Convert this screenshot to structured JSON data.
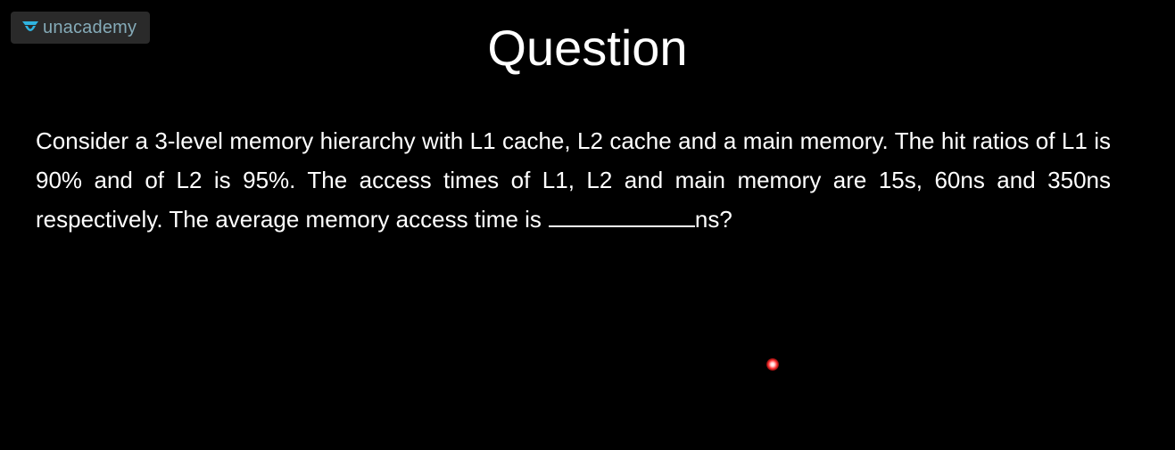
{
  "watermark": {
    "brand": "unacademy",
    "icon": "unacademy-logo-icon",
    "color": "#8fb9c8"
  },
  "slide": {
    "title": "Question",
    "question_text": "Consider a 3-level memory hierarchy with L1 cache, L2 cache and a main memory. The hit ratios of L1 is 90% and of L2 is 95%. The access times of L1, L2 and main memory are 15s, 60ns and 350ns respectively. The average memory access time is",
    "unit_suffix": "ns?"
  },
  "pointer": {
    "icon": "laser-pointer-icon",
    "color": "#ff3030"
  }
}
